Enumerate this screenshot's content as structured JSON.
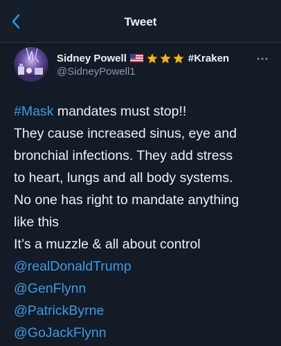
{
  "header": {
    "title": "Tweet",
    "back_icon": "chevron-left-icon"
  },
  "tweet": {
    "author": {
      "name": "Sidney Powell",
      "flag_icon": "us-flag-icon",
      "star_icon": "star-icon",
      "star_count": 3,
      "tag": "#Kraken",
      "handle": "@SidneyPowell1"
    },
    "more_icon": "more-options-icon",
    "hashtag": "#Mask",
    "lines": {
      "l1_rest": "mandates must stop!!",
      "l2": "They cause increased sinus, eye and",
      "l3": "bronchial infections. They add stress",
      "l4": "to heart, lungs and all body systems.",
      "l5": "No one has right to mandate anything",
      "l6": "like this",
      "l7": "It’s a muzzle & all about control"
    },
    "mentions": [
      "@realDonaldTrump",
      "@GenFlynn",
      "@PatrickByrne",
      "@GoJackFlynn"
    ]
  },
  "colors": {
    "background": "#131b26",
    "link": "#3a9be6",
    "star": "#f5b301",
    "secondary_text": "#8d98a5"
  }
}
